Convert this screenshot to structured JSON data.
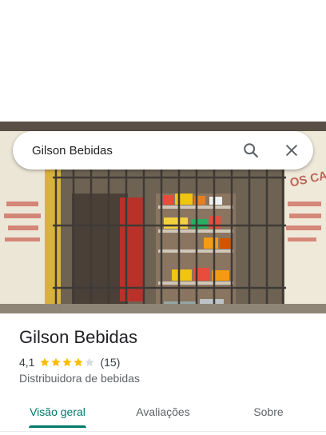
{
  "search": {
    "value": "Gilson Bebidas",
    "search_icon": "search-icon",
    "close_icon": "close-icon"
  },
  "photo": {
    "sign_text": "OS CA"
  },
  "place": {
    "name": "Gilson Bebidas",
    "rating": "4,1",
    "stars_filled": 4.1,
    "stars_total": 5,
    "review_count": "(15)",
    "category": "Distribuidora de bebidas"
  },
  "tabs": [
    {
      "label": "Visão geral",
      "active": true
    },
    {
      "label": "Avaliações",
      "active": false
    },
    {
      "label": "Sobre",
      "active": false
    }
  ],
  "colors": {
    "accent": "#00796b",
    "star": "#fbbc04",
    "star_empty": "#dadce0"
  }
}
